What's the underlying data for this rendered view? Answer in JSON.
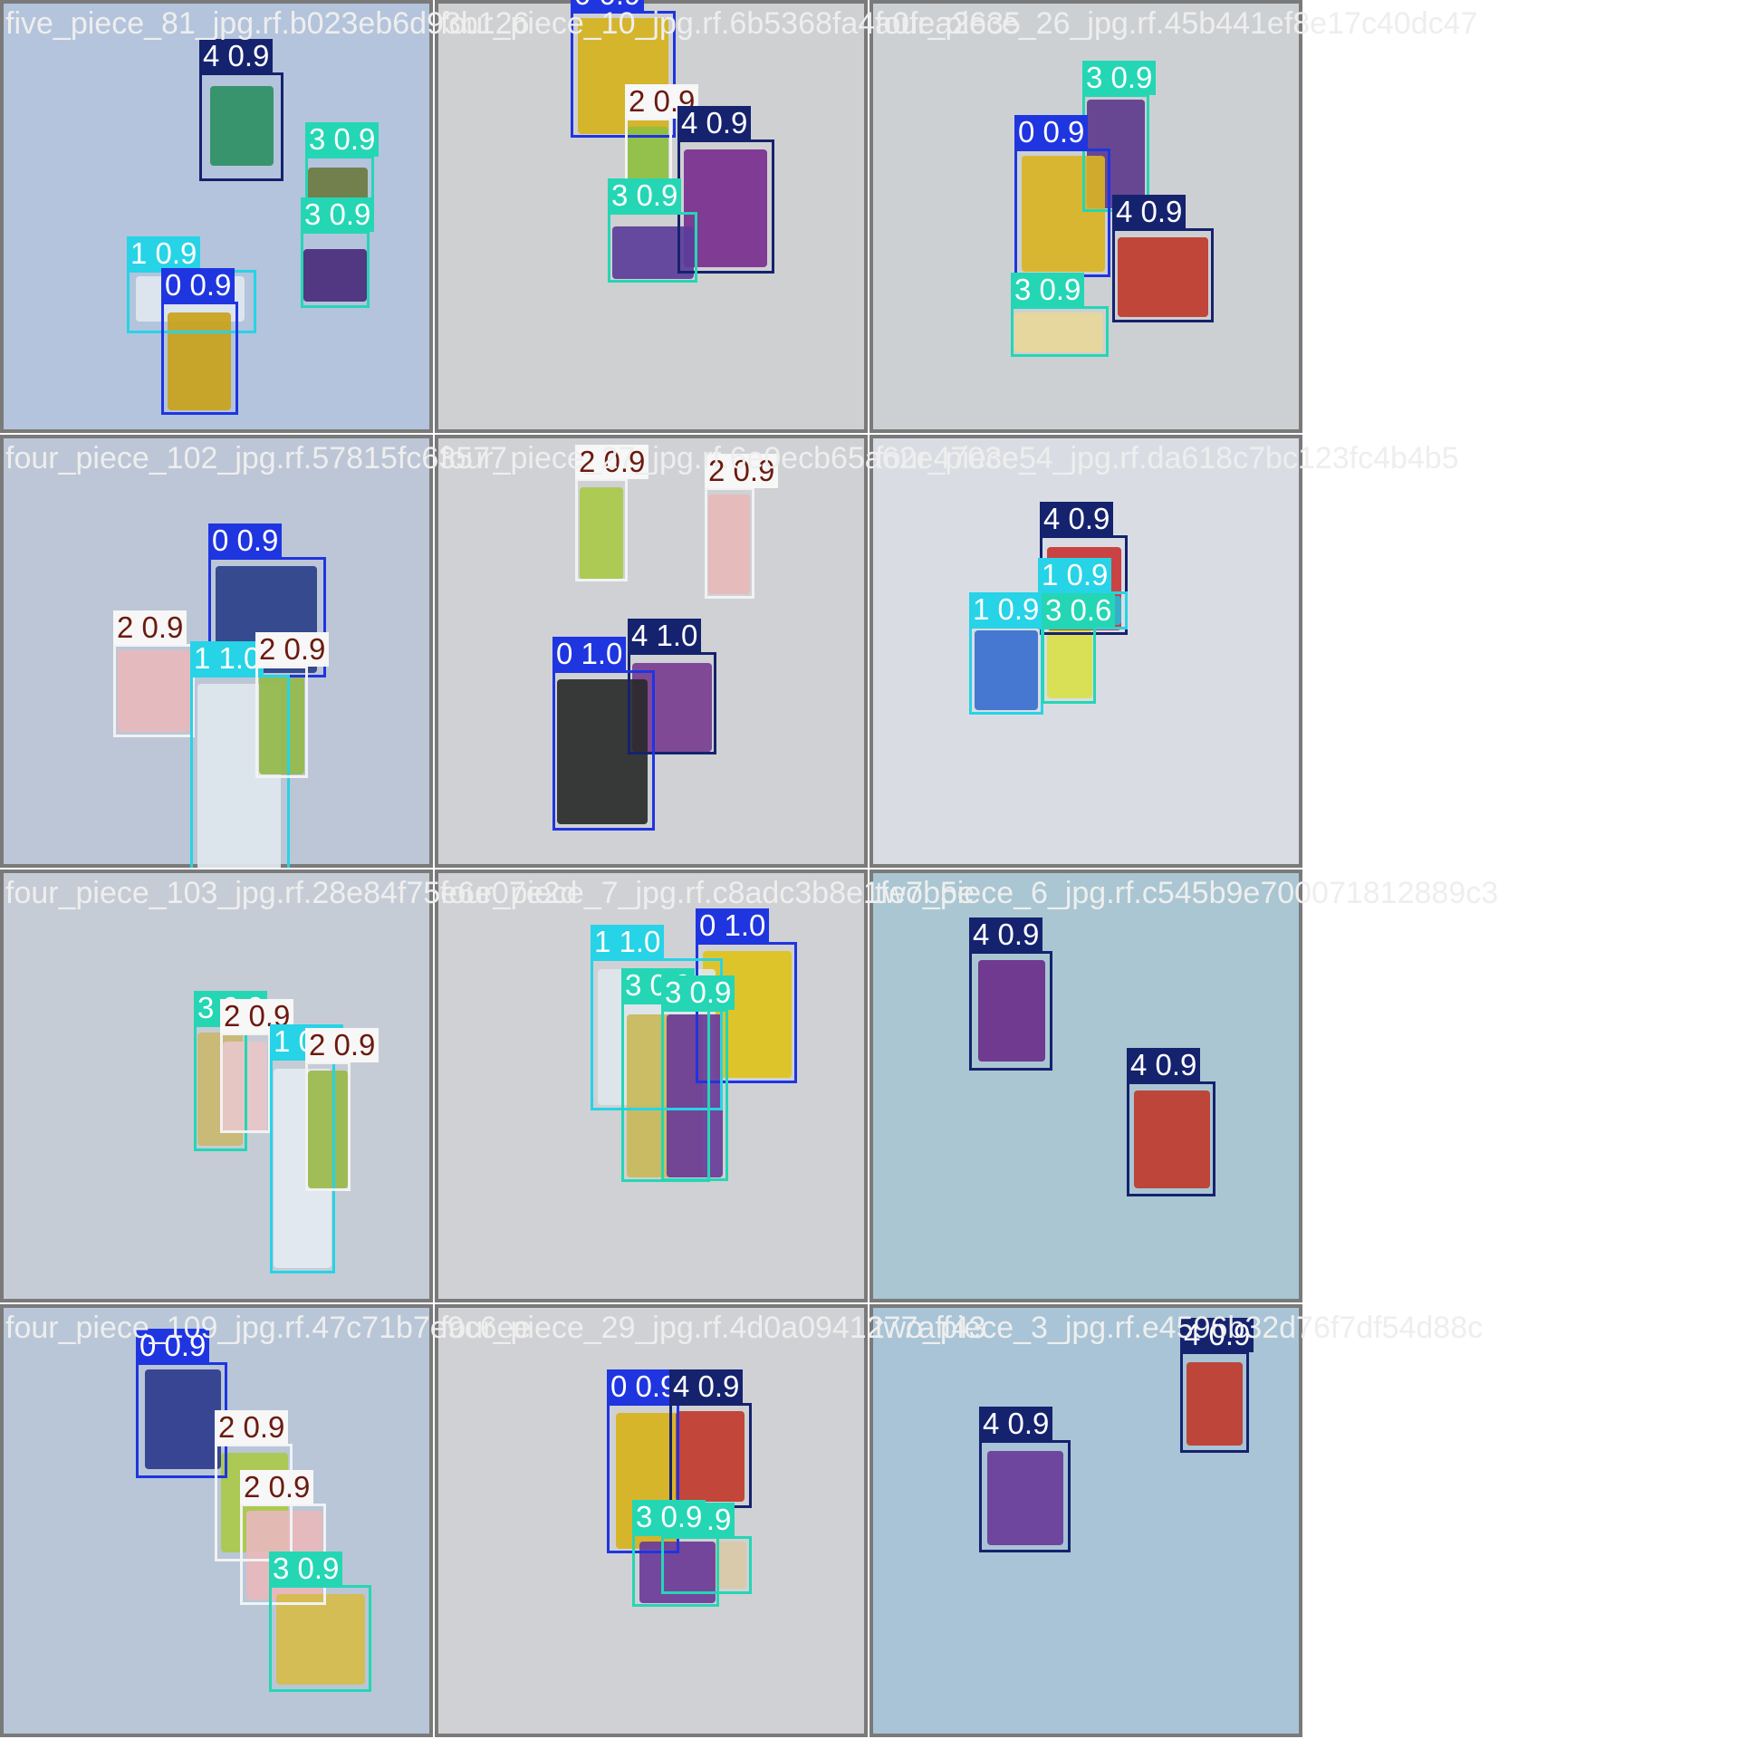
{
  "class_colors": {
    "0": {
      "box": "#1f35e0",
      "label_bg": "#1f35e0",
      "label_text": "#ffffff"
    },
    "1": {
      "box": "#27d3e6",
      "label_bg": "#27d3e6",
      "label_text": "#ffffff"
    },
    "2": {
      "box": "#f2f2f2",
      "label_bg": "#f7f7f7",
      "label_text": "#6b1a10"
    },
    "3": {
      "box": "#25d6b4",
      "label_bg": "#25d6b4",
      "label_text": "#ffffff"
    },
    "4": {
      "box": "#15226e",
      "label_bg": "#15226e",
      "label_text": "#ffffff"
    }
  },
  "tiles": [
    {
      "name": "five_piece_81_jpg.rf.b023eb6d93b126",
      "bg": "#b4c4dc",
      "detections": [
        {
          "label": "4 0.9"
        },
        {
          "label": "3 0.9"
        },
        {
          "label": "3 0.9"
        },
        {
          "label": "1 0.9"
        },
        {
          "label": "0 0.9"
        }
      ]
    },
    {
      "name": "four_piece_10_jpg.rf.6b5368fa4a0fea2635",
      "bg": "#cfd0d2",
      "detections": [
        {
          "label": "0 0.9"
        },
        {
          "label": "2 0.9"
        },
        {
          "label": "4 0.9"
        },
        {
          "label": "3 0.9"
        }
      ]
    },
    {
      "name": "four_piece_26_jpg.rf.45b441ef8e17c40dc47",
      "bg": "#cdd0d3",
      "detections": [
        {
          "label": "3 0.9"
        },
        {
          "label": "0 0.9"
        },
        {
          "label": "4 0.9"
        },
        {
          "label": "3 0.9"
        }
      ]
    },
    {
      "name": "four_piece_102_jpg.rf.57815fc63577",
      "bg": "#bcc6d6",
      "detections": [
        {
          "label": "0 0.9"
        },
        {
          "label": "2 0.9"
        },
        {
          "label": "1 1.0"
        },
        {
          "label": "2 0.9"
        }
      ]
    },
    {
      "name": "four_piece_27_jpg.rf.6e0ecb65a62e4703e5",
      "bg": "#cfd1d4",
      "detections": [
        {
          "label": "2 0.9"
        },
        {
          "label": "2 0.9"
        },
        {
          "label": "4 1.0"
        },
        {
          "label": "0 1.0"
        }
      ]
    },
    {
      "name": "four_piece_4_jpg.rf.da618c7bc123fc4b4b5",
      "bg": "#d9dde3",
      "detections": [
        {
          "label": "4 0.9"
        },
        {
          "label": "1 0.9"
        },
        {
          "label": "1 0.9"
        },
        {
          "label": "3 0.6"
        }
      ]
    },
    {
      "name": "four_piece_103_jpg.rf.28e84f75e6e07e2d",
      "bg": "#c6ccd6",
      "detections": [
        {
          "label": "3 0.9"
        },
        {
          "label": "2 0.9"
        },
        {
          "label": "1 0.9"
        },
        {
          "label": "2 0.9"
        }
      ]
    },
    {
      "name": "four_piece_7_jpg.rf.c8adc3b8e1fe7b5e",
      "bg": "#cfd1d4",
      "detections": [
        {
          "label": "0 1.0"
        },
        {
          "label": "1 1.0"
        },
        {
          "label": "3 0.9"
        },
        {
          "label": "3 0.9"
        }
      ]
    },
    {
      "name": "two_piece_6_jpg.rf.c545b9e700071812889c3",
      "bg": "#a9c6d2",
      "detections": [
        {
          "label": "4 0.9"
        },
        {
          "label": "4 0.9"
        }
      ]
    },
    {
      "name": "four_piece_109_jpg.rf.47c71b7e9c6ee",
      "bg": "#b8c6d8",
      "detections": [
        {
          "label": "0 0.9"
        },
        {
          "label": "2 0.9"
        },
        {
          "label": "2 0.9"
        },
        {
          "label": "3 0.9"
        }
      ]
    },
    {
      "name": "four_piece_29_jpg.rf.4d0a0941277aff43",
      "bg": "#d0d1d4",
      "detections": [
        {
          "label": "0 0.9"
        },
        {
          "label": "4 0.9"
        },
        {
          "label": "3 0.9"
        },
        {
          "label": "3 0.9"
        }
      ]
    },
    {
      "name": "two_piece_3_jpg.rf.e4596b32d76f7df54d88c",
      "bg": "#a8c4d6",
      "detections": [
        {
          "label": "4 0.9"
        },
        {
          "label": "4 0.9"
        }
      ]
    }
  ]
}
